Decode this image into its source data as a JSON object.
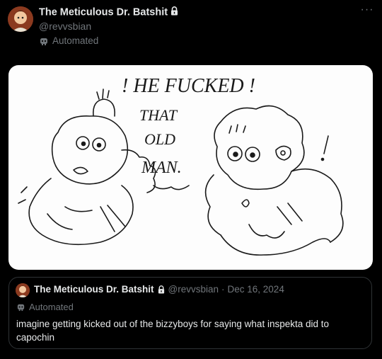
{
  "post": {
    "display_name": "The Meticulous Dr. Batshit",
    "handle": "@revvsbian",
    "automated_label": "Automated",
    "more_label": "···",
    "image_text": [
      "! HE FUCKED !",
      "THAT",
      "OLD",
      "MAN."
    ]
  },
  "quote": {
    "display_name": "The Meticulous Dr. Batshit",
    "handle": "@revvsbian",
    "separator": "·",
    "date": "Dec 16, 2024",
    "automated_label": "Automated",
    "text": "imagine getting kicked out of the bizzyboys for saying what inspekta did to capochin"
  },
  "colors": {
    "background": "#000000",
    "text_primary": "#e7e9ea",
    "text_secondary": "#71767b",
    "border": "#2f3336"
  }
}
